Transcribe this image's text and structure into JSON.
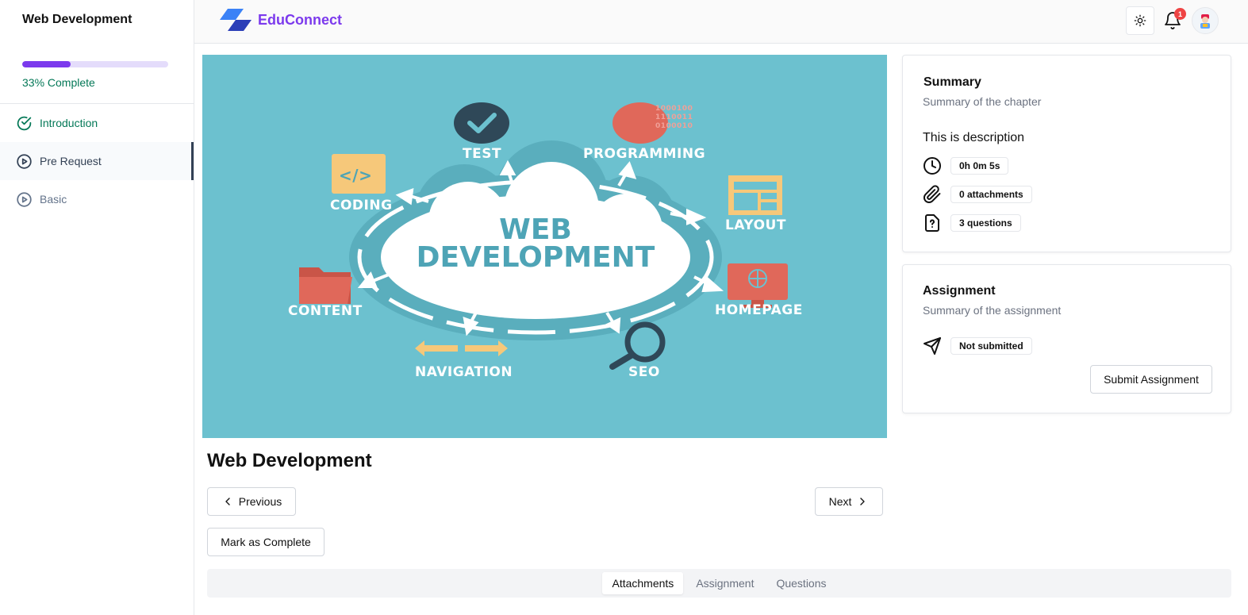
{
  "sidebar": {
    "course_title": "Web Development",
    "progress_percent": 33,
    "progress_label": "33% Complete",
    "chapters": [
      {
        "label": "Introduction",
        "status": "completed"
      },
      {
        "label": "Pre Request",
        "status": "active"
      },
      {
        "label": "Basic",
        "status": "pending"
      }
    ]
  },
  "header": {
    "brand": "EduConnect",
    "notification_count": "1",
    "theme_icon": "sun-icon",
    "bell_icon": "bell-icon"
  },
  "hero": {
    "cloud_line1": "WEB",
    "cloud_line2": "DEVELOPMENT",
    "labels": {
      "test": "TEST",
      "programming": "PROGRAMMING",
      "coding": "CODING",
      "layout": "LAYOUT",
      "content": "CONTENT",
      "homepage": "HOMEPAGE",
      "navigation": "NAVIGATION",
      "seo": "SEO",
      "binary": "1000100 1110011 0100010"
    }
  },
  "lesson": {
    "title": "Web Development",
    "previous_label": "Previous",
    "next_label": "Next",
    "mark_complete_label": "Mark as Complete"
  },
  "tabs": [
    "Attachments",
    "Assignment",
    "Questions"
  ],
  "summary": {
    "title": "Summary",
    "subtitle": "Summary of the chapter",
    "description": "This is description",
    "duration": "0h 0m 5s",
    "attachments": "0 attachments",
    "questions": "3 questions"
  },
  "assignment": {
    "title": "Assignment",
    "subtitle": "Summary of the assignment",
    "status": "Not submitted",
    "submit_label": "Submit Assignment"
  },
  "colors": {
    "brand": "#7c3aed",
    "success": "#047857",
    "hero_bg": "#6cc1cf"
  }
}
